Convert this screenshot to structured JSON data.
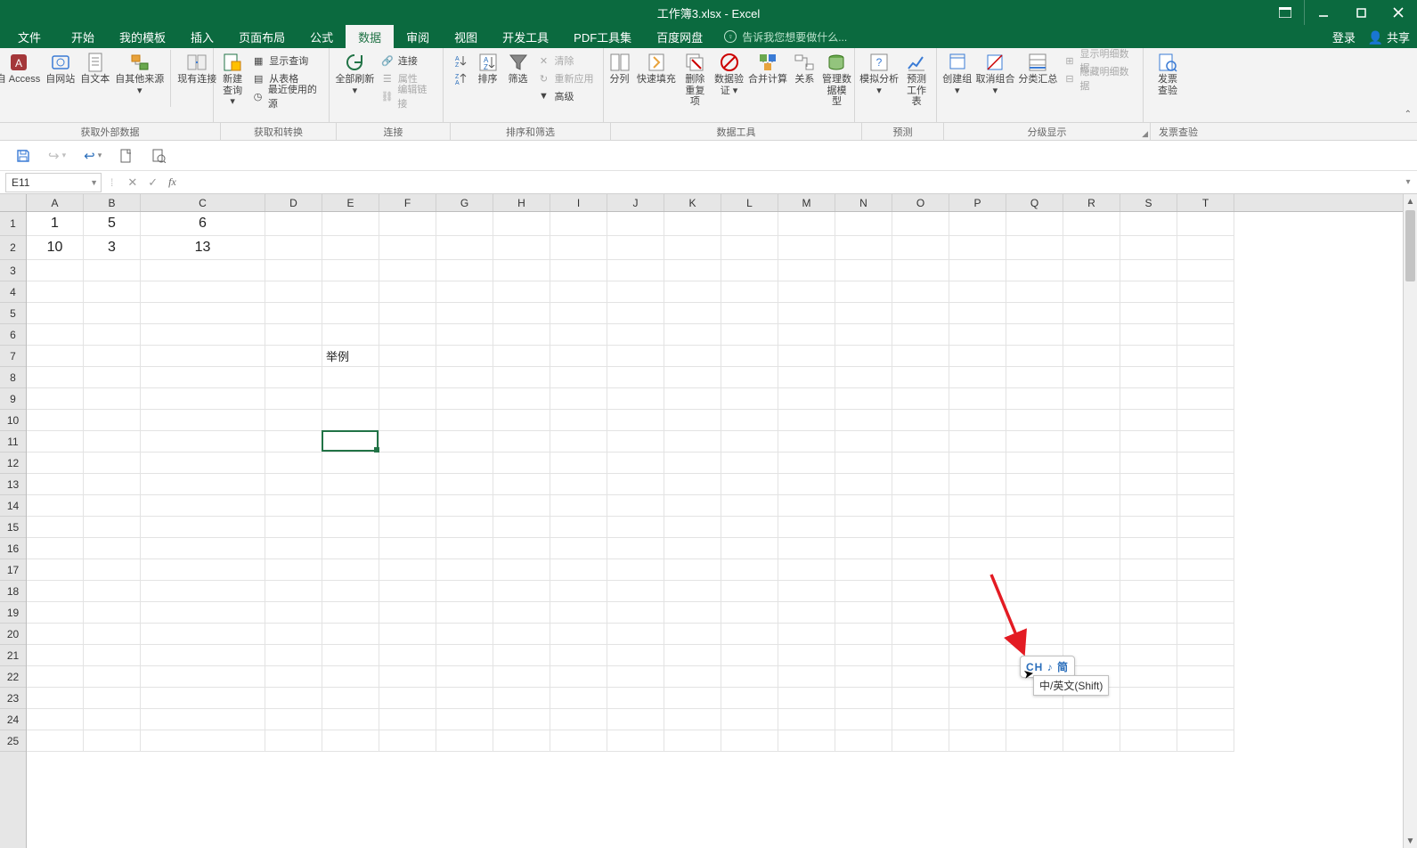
{
  "title": "工作簿3.xlsx - Excel",
  "tabs": {
    "file": "文件",
    "home": "开始",
    "mytpl": "我的模板",
    "insert": "插入",
    "layout": "页面布局",
    "formula": "公式",
    "data": "数据",
    "review": "审阅",
    "view": "视图",
    "dev": "开发工具",
    "pdf": "PDF工具集",
    "baidu": "百度网盘"
  },
  "tellme": "告诉我您想要做什么...",
  "account": {
    "login": "登录",
    "share": "共享"
  },
  "ribbon": {
    "ext": {
      "access": "自 Access",
      "web": "自网站",
      "text": "自文本",
      "other": "自其他来源",
      "existing": "现有连接"
    },
    "get": {
      "newq1": "新建",
      "newq2": "查询",
      "showq": "显示查询",
      "fromtbl": "从表格",
      "recent": "最近使用的源"
    },
    "conn": {
      "refresh": "全部刷新",
      "connections": "连接",
      "properties": "属性",
      "editlinks": "编辑链接"
    },
    "sort": {
      "sort": "排序",
      "filter": "筛选",
      "clear": "清除",
      "reapply": "重新应用",
      "advanced": "高级"
    },
    "tools": {
      "t2c": "分列",
      "flash": "快速填充",
      "dedup1": "删除",
      "dedup2": "重复项",
      "valid1": "数据验",
      "valid2": "证",
      "consol": "合并计算",
      "rel": "关系",
      "mdm1": "管理数",
      "mdm2": "据模型"
    },
    "forecast": {
      "what": "模拟分析",
      "fcst1": "预测",
      "fcst2": "工作表"
    },
    "outline": {
      "group": "创建组",
      "ungroup": "取消组合",
      "subtotal": "分类汇总",
      "showdet": "显示明细数据",
      "hidedet": "隐藏明细数据"
    },
    "invoice": {
      "l1": "发票",
      "l2": "查验"
    }
  },
  "groups": {
    "ext": "获取外部数据",
    "get": "获取和转换",
    "conn": "连接",
    "sort": "排序和筛选",
    "tools": "数据工具",
    "forecast": "预测",
    "outline": "分级显示",
    "invoice": "发票查验"
  },
  "namebox": "E11",
  "formula": "",
  "columns": [
    "A",
    "B",
    "C",
    "D",
    "E",
    "F",
    "G",
    "H",
    "I",
    "J",
    "K",
    "L",
    "M",
    "N",
    "O",
    "P",
    "Q",
    "R",
    "S",
    "T"
  ],
  "rows_shown": 25,
  "cells": {
    "A1": "1",
    "B1": "5",
    "C1": "6",
    "A2": "10",
    "B2": "3",
    "C2": "13",
    "E7": "举例"
  },
  "active_cell": "E11",
  "ime": {
    "badge": "CH ♪ 简",
    "tooltip": "中/英文(Shift)"
  }
}
